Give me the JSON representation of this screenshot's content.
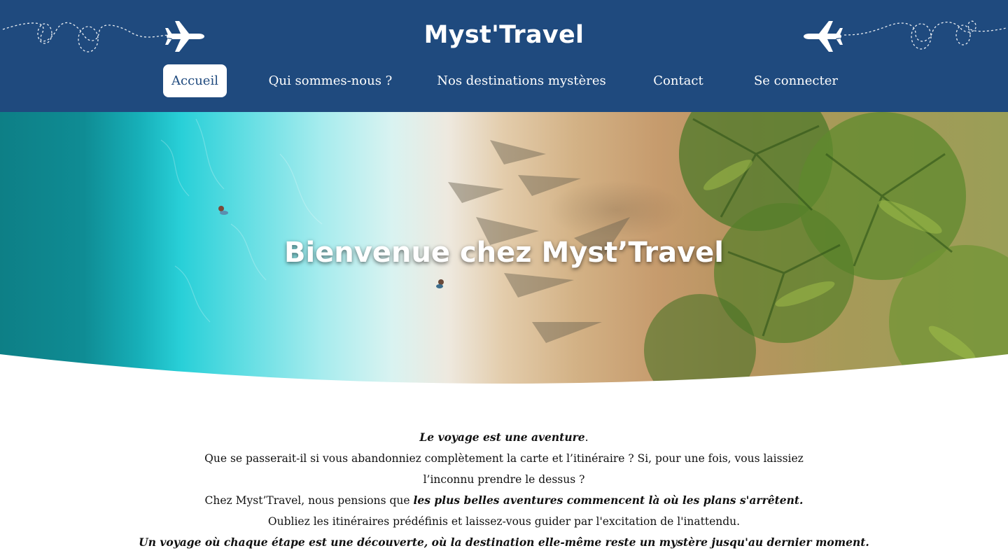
{
  "header": {
    "brand": "Myst'Travel",
    "left_icon": "airplane-icon",
    "right_icon": "airplane-icon",
    "background": "#1f4a7e"
  },
  "nav": {
    "items": [
      {
        "label": "Accueil",
        "active": true
      },
      {
        "label": "Qui sommes-nous ?",
        "active": false
      },
      {
        "label": "Nos destinations mystères",
        "active": false
      },
      {
        "label": "Contact",
        "active": false
      },
      {
        "label": "Se connecter",
        "active": false
      }
    ]
  },
  "hero": {
    "title": "Bienvenue chez Myst’Travel"
  },
  "intro": {
    "line1_bold": "Le voyage est une aventure",
    "line1_tail": ".",
    "line2": "Que se passerait-il si vous abandonniez complètement la carte et l’itinéraire ? Si, pour une fois, vous laissiez l’inconnu prendre le dessus ?",
    "line3_start": "Chez Myst’Travel, nous pensions que ",
    "line3_bold": "les plus belles aventures commencent là où les plans s'arrêtent.",
    "line4": "Oubliez les itinéraires prédéfinis et laissez-vous guider par l'excitation de l'inattendu.",
    "line5_bold": "Un voyage où chaque étape est une découverte, où la destination elle-même reste un mystère jusqu'au dernier moment."
  }
}
